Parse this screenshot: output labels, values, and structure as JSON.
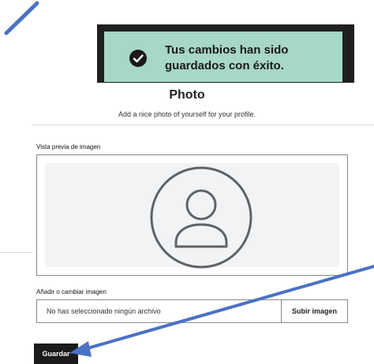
{
  "toast": {
    "icon": "checkmark-circle-icon",
    "line1": "Tus cambios han sido",
    "line2": "guardados con éxito.",
    "background_color": "#a7d7c9"
  },
  "header": {
    "title": "Photo",
    "subtitle": "Add a nice photo of yourself for your profile."
  },
  "preview": {
    "label": "Vista previa de imagen",
    "placeholder_icon": "user-avatar-icon"
  },
  "upload": {
    "label": "Añadir o cambiar imagen",
    "file_status": "No has seleccionado ningún archivo",
    "button_label": "Subir imagen"
  },
  "actions": {
    "save_label": "Guardar"
  },
  "annotations": {
    "arrow_color": "#4a72c4"
  }
}
